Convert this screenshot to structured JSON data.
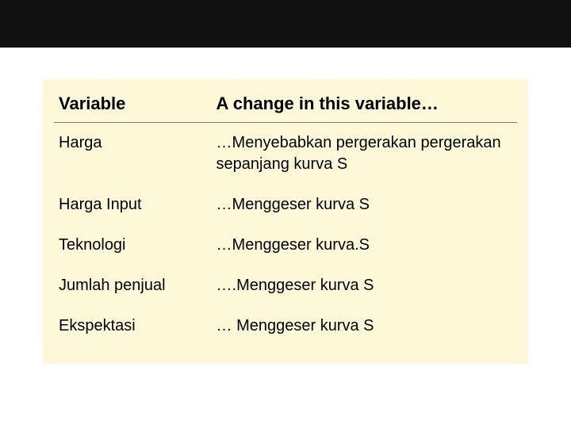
{
  "table": {
    "header": {
      "col1": "Variable",
      "col2": "A change in this variable…"
    },
    "rows": [
      {
        "variable": "Harga",
        "effect": "…Menyebabkan pergerakan pergerakan sepanjang kurva S"
      },
      {
        "variable": "Harga Input",
        "effect": "…Menggeser kurva S"
      },
      {
        "variable": "Teknologi",
        "effect": "…Menggeser kurva.S"
      },
      {
        "variable": "Jumlah penjual",
        "effect": "….Menggeser kurva S"
      },
      {
        "variable": "Ekspektasi",
        "effect": "… Menggeser kurva S"
      }
    ]
  }
}
